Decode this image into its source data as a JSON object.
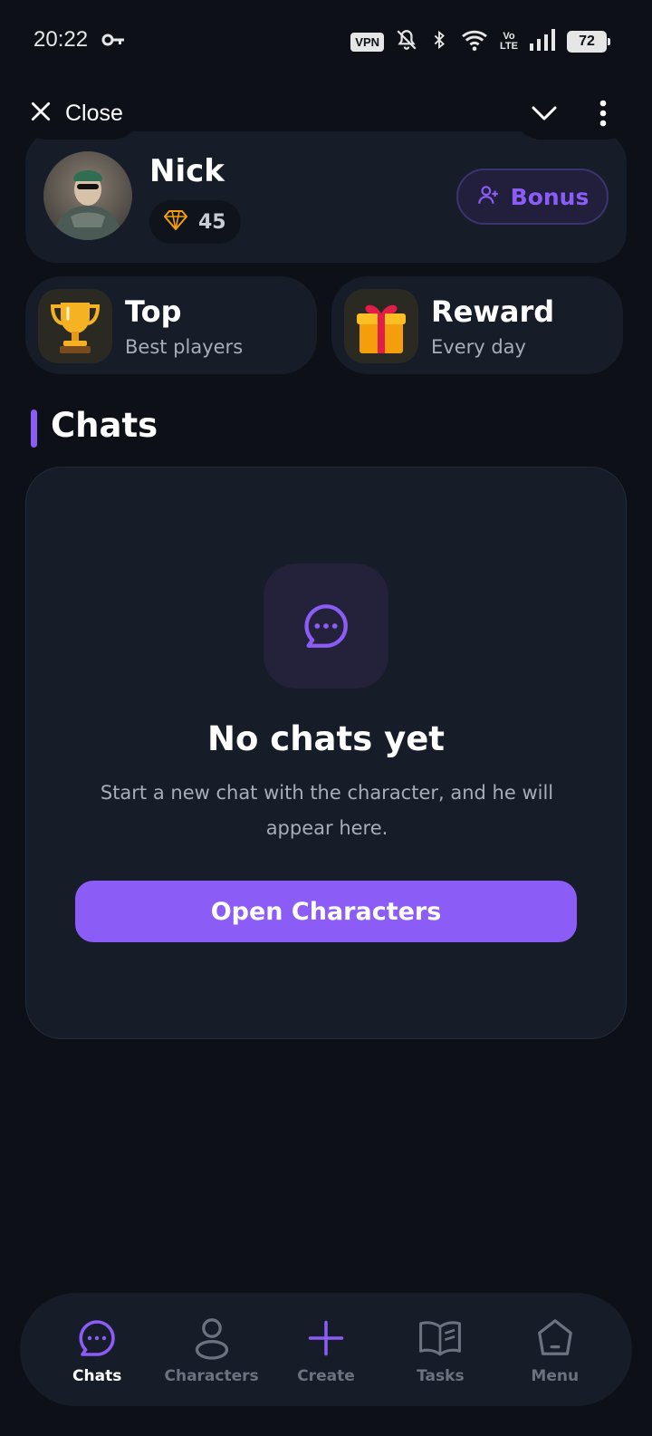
{
  "status_bar": {
    "time": "20:22",
    "vpn": "VPN",
    "volte_top": "Vo",
    "volte_bottom": "LTE",
    "battery": "72"
  },
  "top_bar": {
    "close_label": "Close"
  },
  "profile": {
    "name": "Nick",
    "gems": "45",
    "bonus_label": "Bonus"
  },
  "quick_cards": {
    "top": {
      "title": "Top",
      "subtitle": "Best players"
    },
    "reward": {
      "title": "Reward",
      "subtitle": "Every day"
    }
  },
  "chats_section": {
    "title": "Chats",
    "empty_title": "No chats yet",
    "empty_desc": "Start a new chat with the character, and he will appear here.",
    "open_button": "Open Characters"
  },
  "bottom_nav": {
    "items": [
      {
        "label": "Chats",
        "icon": "chat-bubble-icon",
        "active": true
      },
      {
        "label": "Characters",
        "icon": "person-icon",
        "active": false
      },
      {
        "label": "Create",
        "icon": "plus-icon",
        "active": false
      },
      {
        "label": "Tasks",
        "icon": "book-icon",
        "active": false
      },
      {
        "label": "Menu",
        "icon": "home-icon",
        "active": false
      }
    ]
  },
  "colors": {
    "background": "#0d1117",
    "card": "#161d28",
    "accent": "#8b5cf6",
    "gem": "#f59e0b"
  }
}
